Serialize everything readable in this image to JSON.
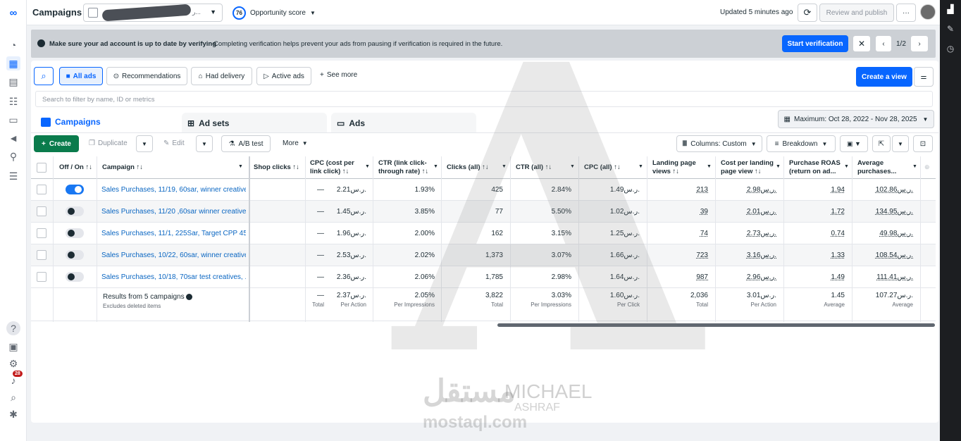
{
  "topbar": {
    "title": "Campaigns",
    "account_text": "ر...",
    "score_value": "76",
    "score_label": "Opportunity score",
    "updated": "Updated 5 minutes ago",
    "review_publish": "Review and publish",
    "more": "···"
  },
  "banner": {
    "title": "Make sure your ad account is up to date by verifying",
    "text": "Completing verification helps prevent your ads from pausing if verification is required in the future.",
    "cta": "Start verification",
    "pager": "1/2"
  },
  "filters": {
    "all_ads": "All ads",
    "recommendations": "Recommendations",
    "had_delivery": "Had delivery",
    "active_ads": "Active ads",
    "see_more": "See more",
    "create_view": "Create a view",
    "search_placeholder": "Search to filter by name, ID or metrics"
  },
  "tabs": {
    "campaigns": "Campaigns",
    "ad_sets": "Ad sets",
    "ads": "Ads",
    "date_range": "Maximum: Oct 28, 2022 - Nov 28, 2025"
  },
  "toolbar": {
    "create": "Create",
    "duplicate": "Duplicate",
    "edit": "Edit",
    "ab_test": "A/B test",
    "more": "More",
    "columns": "Columns: Custom",
    "breakdown": "Breakdown"
  },
  "columns": [
    "Off / On ↑↓",
    "Campaign ↑↓",
    "Shop clicks ↑↓",
    "CPC (cost per link click) ↑↓",
    "CTR (link click-through rate) ↑↓",
    "Clicks (all) ↑↓",
    "CTR (all) ↑↓",
    "CPC (all) ↑↓",
    "Landing page views ↑↓",
    "Cost per landing page view ↑↓",
    "Purchase ROAS (return on ad...",
    "Average purchases..."
  ],
  "rows": [
    {
      "on": true,
      "name": "Sales Purchases, 11/19, 60sar, winner creative",
      "shop": "—",
      "cpc_link": "2.21ر.س.",
      "ctr_link": "1.93%",
      "clicks": "425",
      "ctr_all": "2.84%",
      "cpc_all": "1.49ر.س.",
      "lpv": "213",
      "cost_lpv": "2.98ر.س.",
      "roas": "1.94",
      "avg": "102.86ر.س."
    },
    {
      "on": false,
      "name": "Sales Purchases, 11/20 ,60sar winner creative...",
      "shop": "—",
      "cpc_link": "1.45ر.س.",
      "ctr_link": "3.85%",
      "clicks": "77",
      "ctr_all": "5.50%",
      "cpc_all": "1.02ر.س.",
      "lpv": "39",
      "cost_lpv": "2.01ر.س.",
      "roas": "1.72",
      "avg": "134.95ر.س."
    },
    {
      "on": false,
      "name": "Sales Purchases, 11/1, 225Sar, Target CPP 45...",
      "shop": "—",
      "cpc_link": "1.96ر.س.",
      "ctr_link": "2.00%",
      "clicks": "162",
      "ctr_all": "3.15%",
      "cpc_all": "1.25ر.س.",
      "lpv": "74",
      "cost_lpv": "2.73ر.س.",
      "roas": "0.74",
      "avg": "49.98ر.س."
    },
    {
      "on": false,
      "name": "Sales Purchases, 10/22, 60sar, winner creative",
      "shop": "—",
      "cpc_link": "2.53ر.س.",
      "ctr_link": "2.02%",
      "clicks": "1,373",
      "ctr_all": "3.07%",
      "cpc_all": "1.66ر.س.",
      "lpv": "723",
      "cost_lpv": "3.16ر.س.",
      "roas": "1.33",
      "avg": "108.54ر.س."
    },
    {
      "on": false,
      "name": "Sales Purchases, 10/18, 70sar test creatives, ...",
      "shop": "—",
      "cpc_link": "2.36ر.س.",
      "ctr_link": "2.06%",
      "clicks": "1,785",
      "ctr_all": "2.98%",
      "cpc_all": "1.64ر.س.",
      "lpv": "987",
      "cost_lpv": "2.96ر.س.",
      "roas": "1.49",
      "avg": "111.41ر.س."
    }
  ],
  "totals": {
    "label": "Results from 5 campaigns",
    "sublabel": "Excludes deleted items",
    "shop": "—",
    "shop_sub": "Total",
    "cpc_link": "2.37ر.س.",
    "cpc_link_sub": "Per Action",
    "ctr_link": "2.05%",
    "ctr_link_sub": "Per Impressions",
    "clicks": "3,822",
    "clicks_sub": "Total",
    "ctr_all": "3.03%",
    "ctr_all_sub": "Per Impressions",
    "cpc_all": "1.60ر.س.",
    "cpc_all_sub": "Per Click",
    "lpv": "2,036",
    "lpv_sub": "Total",
    "cost_lpv": "3.01ر.س.",
    "cost_lpv_sub": "Per Action",
    "roas": "1.45",
    "roas_sub": "Average",
    "avg": "107.27ر.س.",
    "avg_sub": "Average"
  },
  "notifications": "28",
  "watermark": {
    "name": "MICHAEL",
    "name2": "ASHRAF",
    "brand": "mostaql.com",
    "brand_ar": "مستقل"
  }
}
